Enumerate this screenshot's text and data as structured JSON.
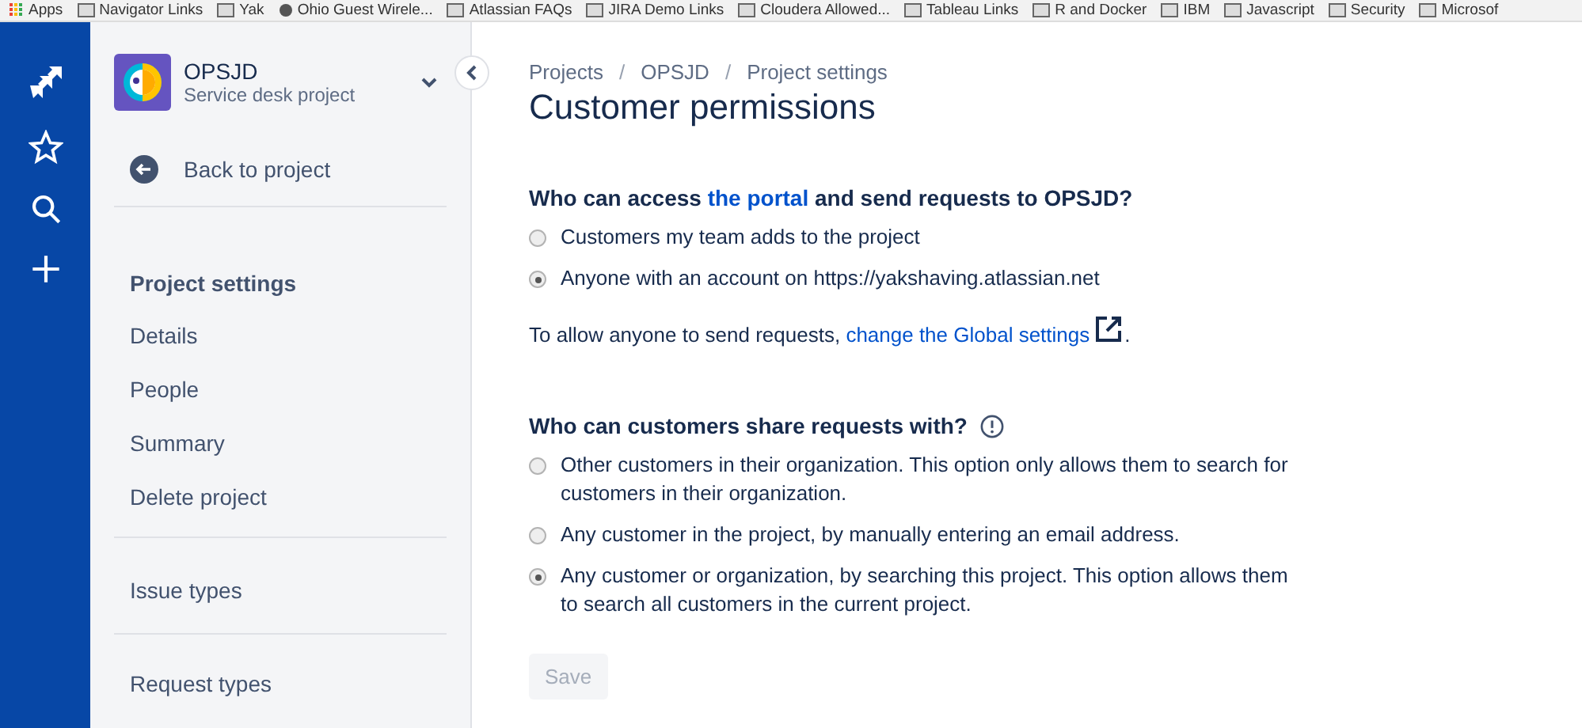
{
  "bookmarks": [
    {
      "kind": "apps",
      "label": "Apps"
    },
    {
      "kind": "folder",
      "label": "Navigator Links"
    },
    {
      "kind": "folder",
      "label": "Yak"
    },
    {
      "kind": "site",
      "label": "Ohio Guest Wirele..."
    },
    {
      "kind": "folder",
      "label": "Atlassian FAQs"
    },
    {
      "kind": "folder",
      "label": "JIRA Demo Links"
    },
    {
      "kind": "folder",
      "label": "Cloudera Allowed..."
    },
    {
      "kind": "folder",
      "label": "Tableau Links"
    },
    {
      "kind": "folder",
      "label": "R and Docker"
    },
    {
      "kind": "folder",
      "label": "IBM"
    },
    {
      "kind": "folder",
      "label": "Javascript"
    },
    {
      "kind": "folder",
      "label": "Security"
    },
    {
      "kind": "folder",
      "label": "Microsof"
    }
  ],
  "project": {
    "name": "OPSJD",
    "type": "Service desk project"
  },
  "sidebar": {
    "back": "Back to project",
    "section": "Project settings",
    "groups": [
      [
        {
          "label": "Details"
        },
        {
          "label": "People"
        },
        {
          "label": "Summary"
        },
        {
          "label": "Delete project"
        }
      ],
      [
        {
          "label": "Issue types"
        }
      ],
      [
        {
          "label": "Request types"
        }
      ]
    ]
  },
  "breadcrumbs": [
    {
      "kind": "link",
      "label": "Projects"
    },
    {
      "kind": "separator",
      "label": "/"
    },
    {
      "kind": "link",
      "label": "OPSJD"
    },
    {
      "kind": "separator",
      "label": "/"
    },
    {
      "kind": "link",
      "label": "Project settings"
    }
  ],
  "title": "Customer permissions",
  "access": {
    "heading_before": "Who can access ",
    "heading_link": "the portal",
    "heading_after": " and send requests to OPSJD?",
    "options": [
      {
        "label": "Customers my team adds to the project",
        "selected": false
      },
      {
        "label": "Anyone with an account on https://yakshaving.atlassian.net",
        "selected": true
      }
    ],
    "note_before": "To allow anyone to send requests, ",
    "note_link": "change the Global settings",
    "note_after": "."
  },
  "sharing": {
    "heading": "Who can customers share requests with?",
    "options": [
      {
        "label": "Other customers in their organization. This option only allows them to search for customers in their organization.",
        "selected": false
      },
      {
        "label": "Any customer in the project, by manually entering an email address.",
        "selected": false
      },
      {
        "label": "Any customer or organization, by searching this project. This option allows them to search all customers in the current project.",
        "selected": true
      }
    ]
  },
  "save": {
    "label": "Save",
    "disabled": true
  }
}
